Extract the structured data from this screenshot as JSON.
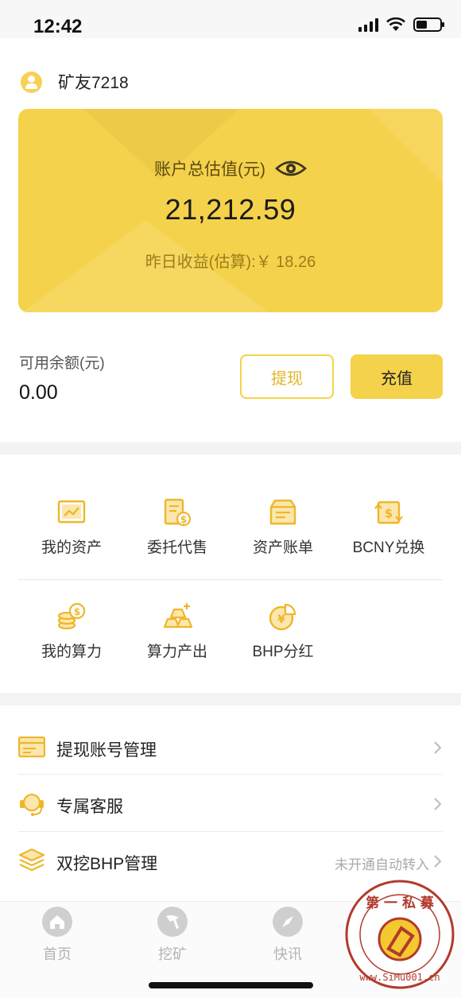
{
  "status_bar": {
    "time": "12:42"
  },
  "user": {
    "name": "矿友7218"
  },
  "card": {
    "label": "账户总估值(元)",
    "amount": "21,212.59",
    "yesterday": "昨日收益(估算):￥ 18.26"
  },
  "balance": {
    "label": "可用余额(元)",
    "value": "0.00",
    "withdraw_label": "提现",
    "recharge_label": "充值"
  },
  "grid": {
    "row1": [
      {
        "label": "我的资产",
        "icon": "chart-icon"
      },
      {
        "label": "委托代售",
        "icon": "dollar-doc-icon"
      },
      {
        "label": "资产账单",
        "icon": "bill-icon"
      },
      {
        "label": "BCNY兑换",
        "icon": "exchange-icon"
      }
    ],
    "row2": [
      {
        "label": "我的算力",
        "icon": "coins-icon"
      },
      {
        "label": "算力产出",
        "icon": "output-icon"
      },
      {
        "label": "BHP分红",
        "icon": "yen-pie-icon"
      }
    ]
  },
  "list": [
    {
      "label": "提现账号管理",
      "extra": "",
      "icon": "card-icon"
    },
    {
      "label": "专属客服",
      "extra": "",
      "icon": "headset-icon"
    },
    {
      "label": "双挖BHP管理",
      "extra": "未开通自动转入",
      "icon": "layers-icon"
    }
  ],
  "tabs": [
    {
      "label": "首页",
      "icon": "home-icon"
    },
    {
      "label": "挖矿",
      "icon": "pickaxe-icon"
    },
    {
      "label": "快讯",
      "icon": "compass-icon"
    }
  ],
  "watermark": {
    "text": "第一私募 www.SiMu001.cn"
  },
  "colors": {
    "accent": "#f5d24b",
    "accent_dark": "#e1b626",
    "page_bg": "#f3f3f3"
  }
}
